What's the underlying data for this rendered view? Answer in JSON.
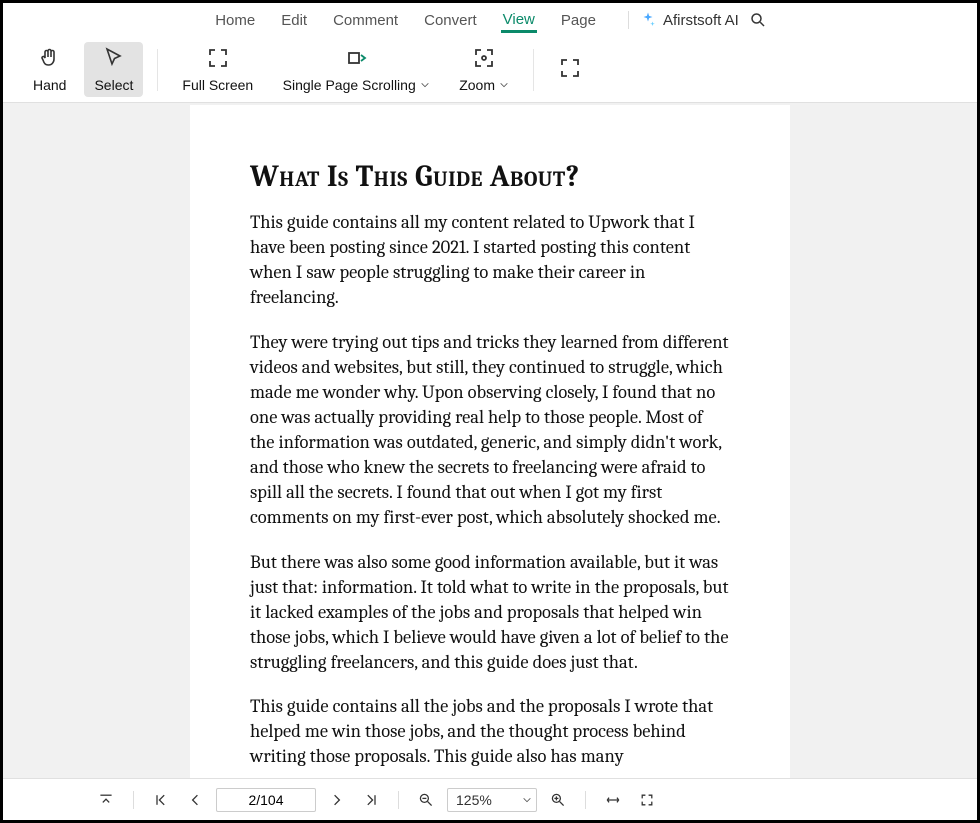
{
  "menu": {
    "tabs": [
      "Home",
      "Edit",
      "Comment",
      "Convert",
      "View",
      "Page"
    ],
    "active_index": 4,
    "ai_label": "Afirstsoft AI"
  },
  "ribbon": {
    "hand": "Hand",
    "select": "Select",
    "full_screen": "Full Screen",
    "single_page_scrolling": "Single Page Scrolling",
    "zoom": "Zoom"
  },
  "document": {
    "heading": "What Is This Guide About?",
    "paragraphs": [
      "This guide contains all my content related to Upwork that I have been posting since 2021. I started posting this content when I saw people struggling to make their career in freelancing.",
      "They were trying out tips and tricks they learned from different videos and websites, but still, they continued to struggle, which made me wonder why. Upon observing closely, I found that no one was actually providing real help to those people. Most of the information was outdated, generic, and simply didn't work, and those who knew the secrets to freelancing were afraid to spill all the secrets. I found that out when I got my first comments on my first-ever post, which absolutely shocked me.",
      "But there was also some good information available, but it was just that: information. It told what to write in the proposals, but it lacked examples of the jobs and proposals that helped win those jobs, which I believe would have given a lot of belief to the struggling freelancers, and this guide does just that.",
      "This guide contains all the jobs and the proposals I wrote that helped me win those jobs, and the thought process behind writing those proposals. This guide also has many"
    ]
  },
  "statusbar": {
    "page_indicator": "2/104",
    "zoom_level": "125%"
  }
}
